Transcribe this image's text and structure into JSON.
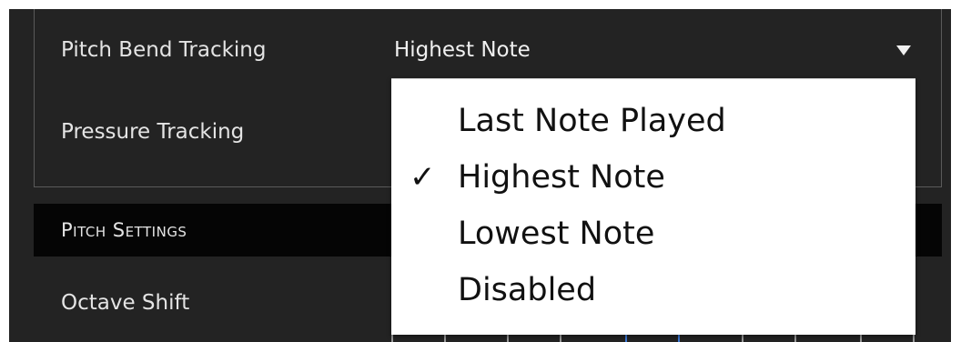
{
  "tracking": {
    "pitch_bend_label": "Pitch Bend Tracking",
    "pitch_bend_value": "Highest Note",
    "pressure_label": "Pressure Tracking"
  },
  "pitch_section": {
    "title": "Pitch Settings",
    "octave_shift_label": "Octave Shift"
  },
  "dropdown": {
    "check_mark": "✓",
    "items": [
      {
        "label": "Last Note Played",
        "selected": false
      },
      {
        "label": "Highest Note",
        "selected": true
      },
      {
        "label": "Lowest Note",
        "selected": false
      },
      {
        "label": "Disabled",
        "selected": false
      }
    ]
  },
  "colors": {
    "panel_bg": "#232323",
    "section_header_bg": "#050505",
    "menu_bg": "#ffffff",
    "active_accent": "#3d7ad8"
  },
  "icons": {
    "select_arrow": "triangle-down-icon",
    "selected_marker": "checkmark-icon"
  }
}
